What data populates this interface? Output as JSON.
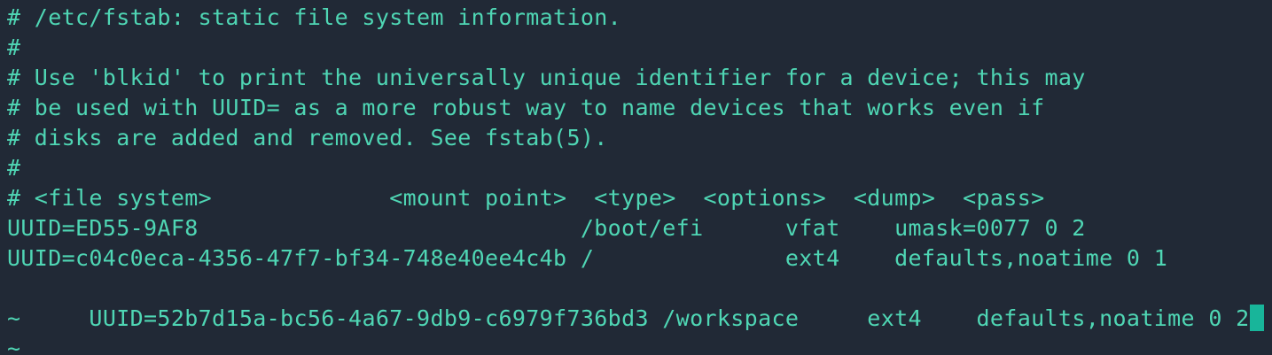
{
  "terminal": {
    "lines": [
      "# /etc/fstab: static file system information.",
      "#",
      "# Use 'blkid' to print the universally unique identifier for a device; this may",
      "# be used with UUID= as a more robust way to name devices that works even if",
      "# disks are added and removed. See fstab(5).",
      "#",
      "# <file system>             <mount point>  <type>  <options>  <dump>  <pass>",
      "UUID=ED55-9AF8                            /boot/efi      vfat    umask=0077 0 2",
      "UUID=c04c0eca-4356-47f7-bf34-748e40ee4c4b /              ext4    defaults,noatime 0 1",
      "UUID=52b7d15a-bc56-4a67-9db9-c6979f736bd3 /workspace     ext4    defaults,noatime 0 2"
    ],
    "empty_line_marker": "~",
    "colors": {
      "background": "#212936",
      "text": "#4fd6b4",
      "cursor": "#18b59a"
    }
  }
}
